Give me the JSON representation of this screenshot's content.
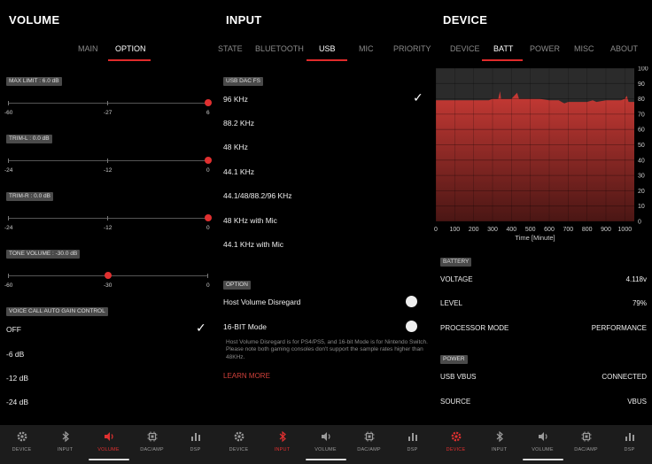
{
  "colors": {
    "accent": "#e03030",
    "tag_bg": "#4a4a4a",
    "nav_bg": "#1c1c1c"
  },
  "volume": {
    "title": "VOLUME",
    "tabs": [
      "MAIN",
      "OPTION"
    ],
    "active_tab": "OPTION",
    "max_limit": {
      "label": "MAX LIMIT : 6.0 dB",
      "ticks": [
        "-60",
        "-27",
        "6"
      ],
      "value": 6
    },
    "trim_l": {
      "label": "TRIM-L : 0.0 dB",
      "ticks": [
        "-24",
        "-12",
        "0"
      ],
      "value": 0
    },
    "trim_r": {
      "label": "TRIM-R : 0.0 dB",
      "ticks": [
        "-24",
        "-12",
        "0"
      ],
      "value": 0
    },
    "tone": {
      "label": "TONE VOLUME : -30.0 dB",
      "ticks": [
        "-60",
        "-30",
        "0"
      ],
      "value": -30
    },
    "agc_label": "VOICE CALL AUTO GAIN CONTROL",
    "agc_options": [
      "OFF",
      "-6 dB",
      "-12 dB",
      "-24 dB"
    ],
    "agc_selected": "OFF"
  },
  "input": {
    "title": "INPUT",
    "tabs": [
      "STATE",
      "BLUETOOTH",
      "USB",
      "MIC",
      "PRIORITY"
    ],
    "active_tab": "USB",
    "usb_label": "USB DAC FS",
    "rates": [
      "96 KHz",
      "88.2 KHz",
      "48 KHz",
      "44.1 KHz",
      "44.1/48/88.2/96 KHz",
      "48 KHz with Mic",
      "44.1 KHz with Mic"
    ],
    "selected_rate": "96 KHz",
    "option_label": "OPTION",
    "host_volume": "Host Volume Disregard",
    "bit16": "16-BIT Mode",
    "note": "Host Volume Disregard is for PS4/PS5, and 16-bit Mode is for Nintendo Switch. Please note both gaming consoles don't support the sample rates higher than 48KHz.",
    "learn_more": "LEARN MORE"
  },
  "device": {
    "title": "DEVICE",
    "tabs": [
      "DEVICE",
      "BATT",
      "POWER",
      "MISC",
      "ABOUT"
    ],
    "active_tab": "BATT",
    "battery_label": "BATTERY",
    "voltage_label": "VOLTAGE",
    "voltage": "4.118v",
    "level_label": "LEVEL",
    "level": "79%",
    "proc_label": "PROCESSOR MODE",
    "proc": "PERFORMANCE",
    "power_label": "POWER",
    "vbus_label": "USB VBUS",
    "vbus": "CONNECTED",
    "source_label": "SOURCE",
    "source": "VBUS"
  },
  "chart_data": {
    "type": "area",
    "xlabel": "Time [Minute]",
    "x_ticks": [
      "0",
      "100",
      "200",
      "300",
      "400",
      "500",
      "600",
      "700",
      "800",
      "900",
      "1000"
    ],
    "y_ticks": [
      "100",
      "90",
      "80",
      "70",
      "60",
      "50",
      "40",
      "30",
      "20",
      "10",
      "0"
    ],
    "xlim": [
      0,
      1050
    ],
    "ylim": [
      0,
      100
    ],
    "series": [
      {
        "values": [
          [
            0,
            79
          ],
          [
            100,
            79
          ],
          [
            200,
            79
          ],
          [
            280,
            79
          ],
          [
            300,
            80
          ],
          [
            330,
            80
          ],
          [
            340,
            85
          ],
          [
            345,
            80
          ],
          [
            360,
            80
          ],
          [
            400,
            80
          ],
          [
            430,
            84
          ],
          [
            440,
            80
          ],
          [
            470,
            80
          ],
          [
            500,
            80
          ],
          [
            550,
            80
          ],
          [
            600,
            79
          ],
          [
            650,
            79
          ],
          [
            680,
            77
          ],
          [
            700,
            78
          ],
          [
            720,
            78
          ],
          [
            750,
            78
          ],
          [
            800,
            78
          ],
          [
            830,
            79
          ],
          [
            850,
            78
          ],
          [
            900,
            79
          ],
          [
            950,
            79
          ],
          [
            980,
            79
          ],
          [
            1000,
            80
          ],
          [
            1010,
            82
          ],
          [
            1020,
            78
          ],
          [
            1050,
            78
          ]
        ]
      }
    ]
  },
  "nav": {
    "items": [
      {
        "label": "DEVICE",
        "icon": "gear-icon"
      },
      {
        "label": "INPUT",
        "icon": "bluetooth-icon"
      },
      {
        "label": "VOLUME",
        "icon": "speaker-icon"
      },
      {
        "label": "DAC/AMP",
        "icon": "chip-icon"
      },
      {
        "label": "DSP",
        "icon": "bars-icon"
      }
    ],
    "active": {
      "p1": "VOLUME",
      "p2": "INPUT",
      "p3": "DEVICE"
    }
  }
}
